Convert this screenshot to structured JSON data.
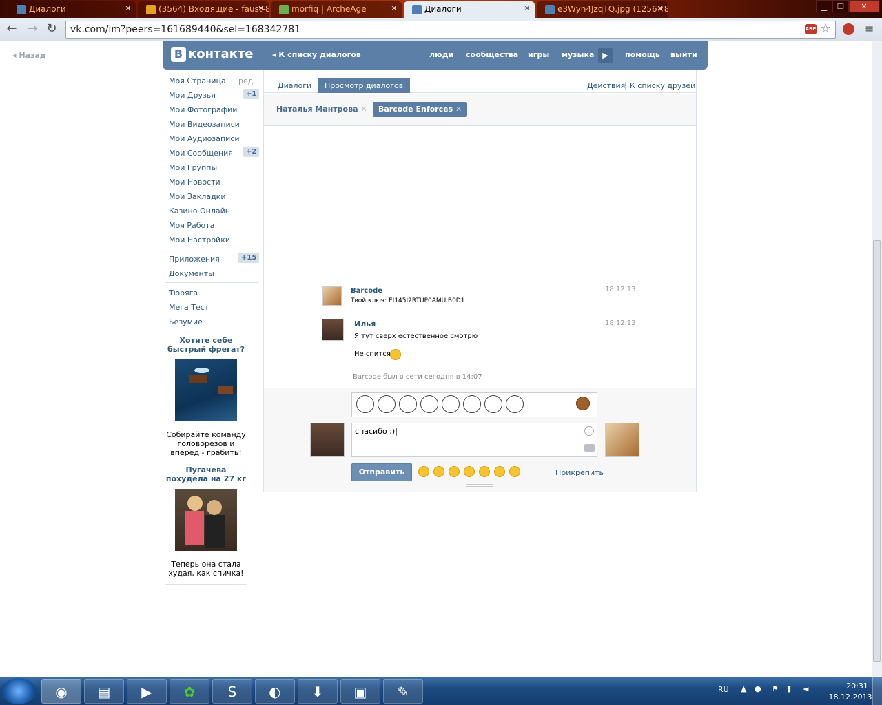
{
  "browser": {
    "tabs": [
      {
        "title": "Диалоги",
        "active": false,
        "fav": "#4e7fb5"
      },
      {
        "title": "(3564) Входящие - faust-8",
        "active": false,
        "fav": "#e6a21f"
      },
      {
        "title": "morfiq | ArcheAge",
        "active": false,
        "fav": "#6ab04c"
      },
      {
        "title": "Диалоги",
        "active": true,
        "fav": "#4e7fb5"
      },
      {
        "title": "e3Wyn4JzqTQ.jpg (1256×8",
        "active": false,
        "fav": "#4e7fb5"
      }
    ],
    "url": "vk.com/im?peers=161689440&sel=168342781",
    "abp": "ABP"
  },
  "vk": {
    "back_label": "Назад",
    "logo_letter": "В",
    "logo_text": "контакте",
    "back_to_dialogs": "К списку диалогов",
    "nav": [
      "люди",
      "сообщества",
      "игры",
      "музыка",
      "помощь",
      "выйти"
    ]
  },
  "sidebar": {
    "edit": "ред.",
    "items": [
      {
        "label": "Моя Страница"
      },
      {
        "label": "Мои Друзья",
        "count": "+1"
      },
      {
        "label": "Мои Фотографии"
      },
      {
        "label": "Мои Видеозаписи"
      },
      {
        "label": "Мои Аудиозаписи"
      },
      {
        "label": "Мои Сообщения",
        "count": "+2"
      },
      {
        "label": "Мои Группы"
      },
      {
        "label": "Мои Новости"
      },
      {
        "label": "Мои Закладки"
      },
      {
        "label": "Казино Онлайн"
      },
      {
        "label": "Моя Работа"
      },
      {
        "label": "Мои Настройки"
      }
    ],
    "items2": [
      {
        "label": "Приложения",
        "count": "+15"
      },
      {
        "label": "Документы"
      }
    ],
    "items3": [
      "Тюряга",
      "Мега Тест",
      "Безумие"
    ],
    "ads": [
      {
        "title": "Хотите себе быстрый фрегат?",
        "text": "Собирайте команду головорезов и вперед - грабить!"
      },
      {
        "title": "Пугачева похудела на 27 кг",
        "text": "Теперь она стала худая, как спичка!"
      }
    ]
  },
  "dialog": {
    "tabs": [
      "Диалоги",
      "Просмотр диалогов"
    ],
    "actions": "Действия",
    "to_friends": "К списку друзей",
    "chips": [
      "Наталья Мантрова",
      "Barcode Enforces"
    ],
    "messages": [
      {
        "name": "Barcode",
        "date": "18.12.13",
        "lines": [
          "Твой ключ: EI145I2RTUP0AMUIB0D1"
        ]
      },
      {
        "name": "Илья",
        "date": "18.12.13",
        "lines": [
          "Я тут сверх естественное смотрю",
          "Не спится"
        ]
      }
    ],
    "online_status": "Barcode был в сети сегодня в 14:07",
    "input_value": "спасибо ;)",
    "send_label": "Отправить",
    "attach_label": "Прикрепить"
  },
  "tray": {
    "lang": "RU",
    "time": "20:31",
    "date": "18.12.2013"
  }
}
